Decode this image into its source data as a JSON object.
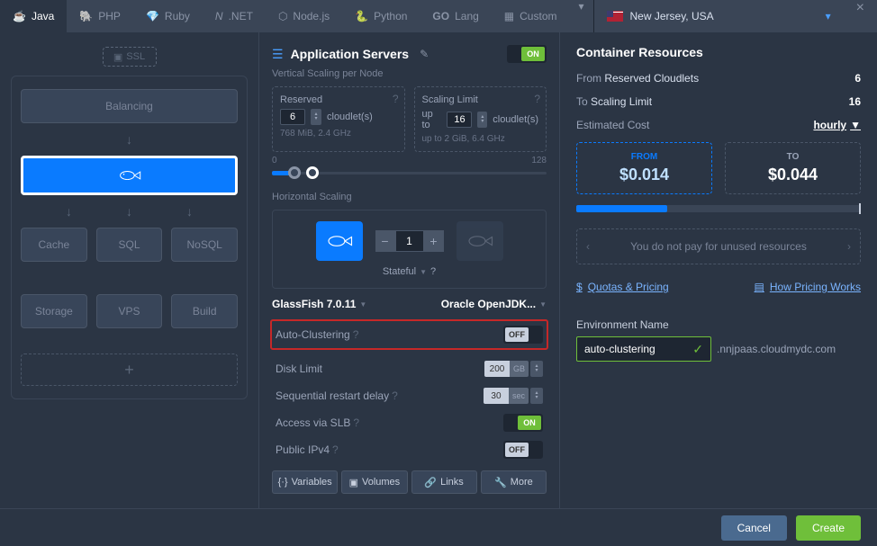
{
  "tabs": [
    "Java",
    "PHP",
    "Ruby",
    ".NET",
    "Node.js",
    "Python",
    "Lang",
    "Custom"
  ],
  "region": {
    "label": "New Jersey, USA"
  },
  "left": {
    "ssl": "SSL",
    "balancing": "Balancing",
    "cache": "Cache",
    "sql": "SQL",
    "nosql": "NoSQL",
    "storage": "Storage",
    "vps": "VPS",
    "build": "Build"
  },
  "mid": {
    "title": "Application Servers",
    "toggle": "ON",
    "vscaling": "Vertical Scaling per Node",
    "reserved": {
      "label": "Reserved",
      "val": "6",
      "unit": "cloudlet(s)",
      "detail": "768 MiB, 2.4 GHz"
    },
    "limit": {
      "label": "Scaling Limit",
      "pre": "up to",
      "val": "16",
      "unit": "cloudlet(s)",
      "detail": "up to 2 GiB, 6.4 GHz"
    },
    "slider": {
      "min": "0",
      "max": "128"
    },
    "hscaling": "Horizontal Scaling",
    "count": "1",
    "stateful": "Stateful",
    "stack": "GlassFish 7.0.11",
    "jdk": "Oracle OpenJDK...",
    "autocluster": {
      "label": "Auto-Clustering",
      "val": "OFF"
    },
    "disk": {
      "label": "Disk Limit",
      "val": "200",
      "unit": "GB"
    },
    "seq": {
      "label": "Sequential restart delay",
      "val": "30",
      "unit": "sec"
    },
    "slb": {
      "label": "Access via SLB",
      "val": "ON"
    },
    "ipv4": {
      "label": "Public IPv4",
      "val": "OFF"
    },
    "btns": {
      "vars": "Variables",
      "vols": "Volumes",
      "links": "Links",
      "more": "More"
    }
  },
  "right": {
    "title": "Container Resources",
    "from_label": "From",
    "from_item": "Reserved Cloudlets",
    "from_val": "6",
    "to_label": "To",
    "to_item": "Scaling Limit",
    "to_val": "16",
    "est": "Estimated Cost",
    "est_unit": "hourly",
    "price_from_label": "FROM",
    "price_from": "$0.014",
    "price_to_label": "TO",
    "price_to": "$0.044",
    "info": "You do not pay for unused resources",
    "quotas": "Quotas & Pricing",
    "howpricing": "How Pricing Works",
    "env_label": "Environment Name",
    "env_val": "auto-clustering",
    "env_domain": ".nnjpaas.cloudmydc.com"
  },
  "footer": {
    "cancel": "Cancel",
    "create": "Create"
  }
}
